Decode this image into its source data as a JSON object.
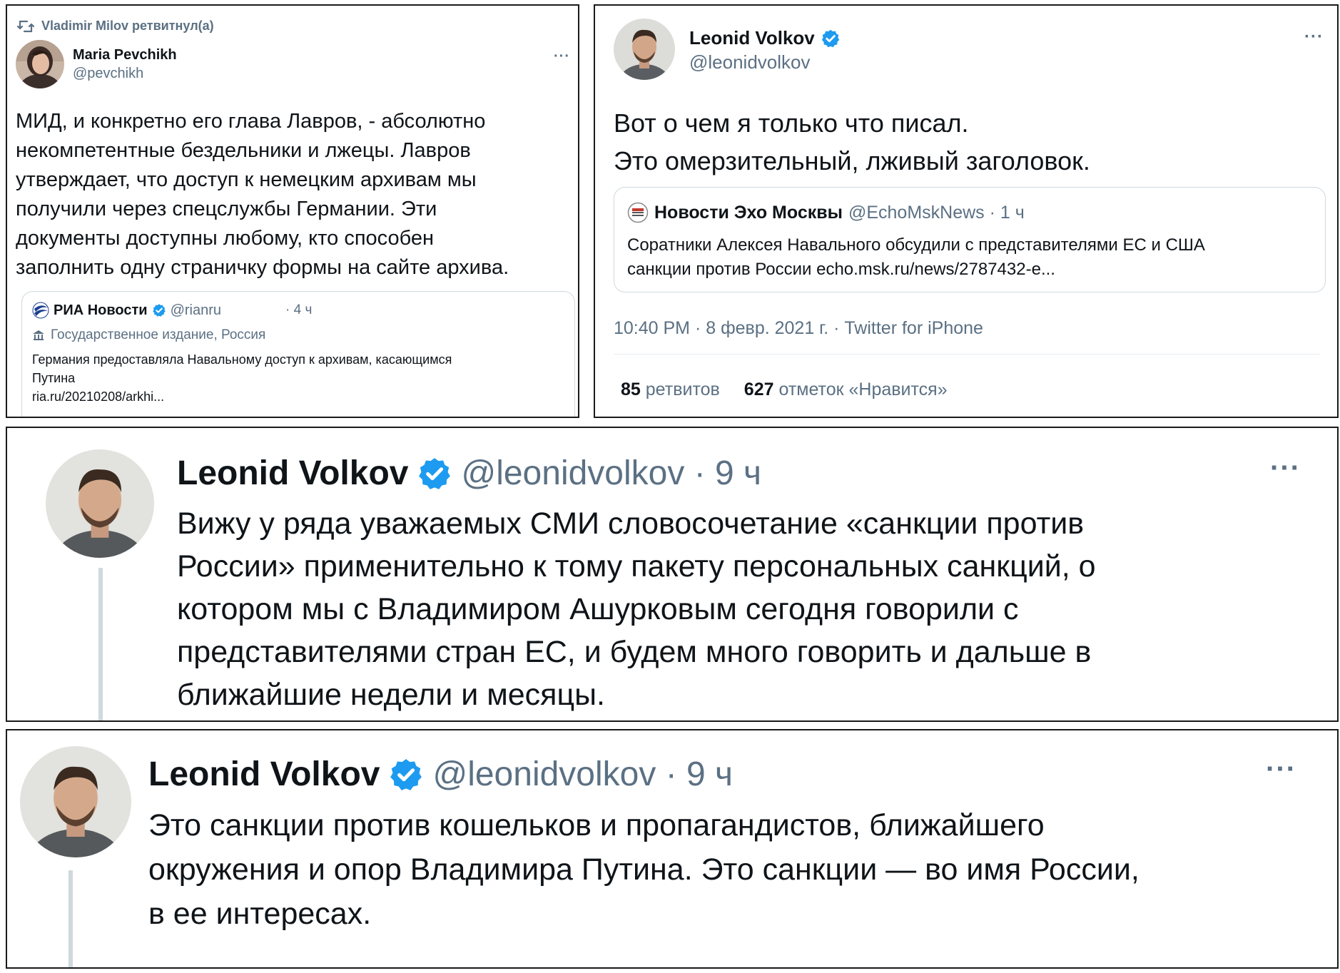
{
  "tweet1": {
    "retweeted_by": "Vladimir Milov ретвитнул(а)",
    "author_name": "Maria Pevchikh",
    "author_handle": "@pevchikh",
    "more_label": "···",
    "text": "МИД, и конкретно его глава Лавров, - абсолютно\nнекомпетентные бездельники и лжецы.  Лавров\nутверждает, что доступ к немецким архивам мы\nполучили через спецслужбы Германии. Эти\nдокументы доступны любому, кто способен\nзаполнить одну страничку формы на сайте архива.",
    "quote": {
      "author_name": "РИА Новости",
      "author_handle": "@rianru",
      "time": "· 4 ч",
      "label": "Государственное издание, Россия",
      "text": "Германия предоставляла Навальному доступ к архивам, касающимся\nПутина\nria.ru/20210208/arkhi..."
    }
  },
  "tweet2": {
    "author_name": "Leonid Volkov",
    "author_handle": "@leonidvolkov",
    "more_label": "···",
    "text": "Вот о чем я только что писал.\nЭто омерзительный, лживый заголовок.",
    "quote": {
      "author_name": "Новости Эхо Москвы",
      "author_handle": "@EchoMskNews · 1 ч",
      "text": "Соратники Алексея Навального обсудили с представителями ЕС и США\nсанкции против России echo.msk.ru/news/2787432-e..."
    },
    "meta": "10:40 PM · 8 февр. 2021 г. · Twitter for iPhone",
    "retweets_count": "85",
    "retweets_label": "ретвитов",
    "likes_count": "627",
    "likes_label": "отметок «Нравится»"
  },
  "tweet3": {
    "author_name": "Leonid Volkov",
    "author_handle": "@leonidvolkov · 9 ч",
    "more_label": "···",
    "text": "Вижу у ряда уважаемых СМИ словосочетание «санкции против\nРоссии» применительно к тому пакету персональных санкций, о\nкотором мы с Владимиром Ашурковым сегодня говорили с\nпредставителями стран ЕС, и будем много говорить и дальше в\nближайшие недели и месяцы."
  },
  "tweet4": {
    "author_name": "Leonid Volkov",
    "author_handle": "@leonidvolkov · 9 ч",
    "more_label": "···",
    "text": "Это санкции против кошельков и пропагандистов, ближайшего\nокружения и опор Владимира Путина. Это санкции — во имя России,\nв ее интересах."
  },
  "colors": {
    "verified": "#1d9bf0",
    "secondary_text": "#5b7083",
    "primary_text": "#0f1419",
    "quote_border": "#cfd9de"
  },
  "icons": {
    "retweet": "retweet-icon",
    "verified": "verified-badge-icon",
    "state_media": "state-media-icon",
    "more": "more-dots-icon"
  }
}
